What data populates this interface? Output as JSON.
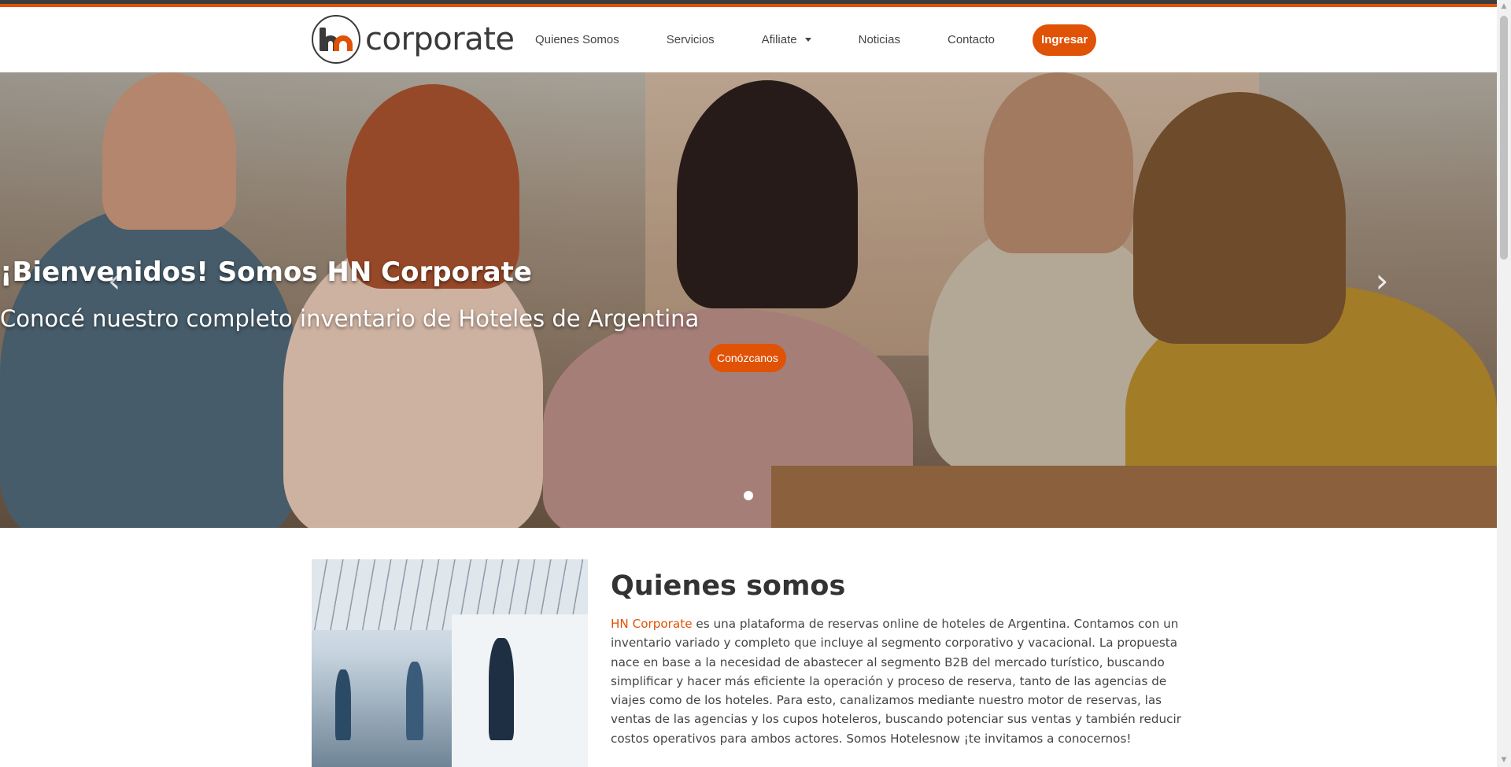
{
  "header": {
    "logo_text": "corporate",
    "nav": [
      {
        "label": "Quienes Somos"
      },
      {
        "label": "Servicios"
      },
      {
        "label": "Afiliate"
      },
      {
        "label": "Noticias"
      },
      {
        "label": "Contacto"
      }
    ],
    "login_label": "Ingresar"
  },
  "hero": {
    "title": "¡Bienvenidos! Somos HN Corporate",
    "subtitle": "Conocé nuestro completo inventario de Hoteles de Argentina",
    "cta_label": "Conózcanos",
    "prev_icon": "‹",
    "next_icon": "›"
  },
  "about": {
    "title": "Quienes somos",
    "brand": "HN Corporate",
    "text": " es una plataforma de reservas online de hoteles de Argentina. Contamos con un inventario variado y completo que incluye al segmento corporativo y vacacional. La propuesta nace en base a la necesidad de abastecer al segmento B2B del mercado turístico, buscando simplificar y hacer más eficiente la operación y proceso de reserva, tanto de las agencias de viajes como de los hoteles. Para esto, canalizamos mediante nuestro motor de reservas, las ventas de las agencias y los cupos hoteleros, buscando potenciar sus ventas y también reducir costos operativos para ambos actores. Somos Hotelesnow ¡te invitamos a conocernos!"
  },
  "colors": {
    "accent": "#e05206",
    "dark": "#3a3a3a"
  }
}
